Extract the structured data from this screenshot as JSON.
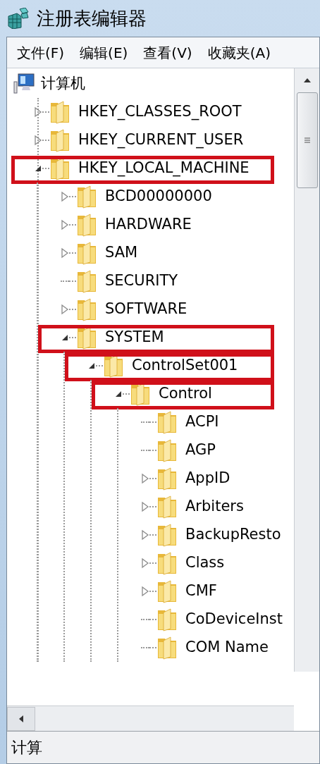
{
  "window": {
    "title": "注册表编辑器"
  },
  "menu": [
    {
      "label": "文件(F)"
    },
    {
      "label": "编辑(E)"
    },
    {
      "label": "查看(V)"
    },
    {
      "label": "收藏夹(A)"
    }
  ],
  "tree": {
    "label": "计算机",
    "children": [
      {
        "label": "HKEY_CLASSES_ROOT",
        "kind": "branch",
        "expanded": false,
        "annotated": false
      },
      {
        "label": "HKEY_CURRENT_USER",
        "kind": "branch",
        "expanded": false,
        "annotated": false
      },
      {
        "label": "HKEY_LOCAL_MACHINE",
        "kind": "branch",
        "expanded": true,
        "annotated": true,
        "children": [
          {
            "label": "BCD00000000",
            "kind": "branch",
            "expanded": false,
            "annotated": false
          },
          {
            "label": "HARDWARE",
            "kind": "branch",
            "expanded": false,
            "annotated": false
          },
          {
            "label": "SAM",
            "kind": "branch",
            "expanded": false,
            "annotated": false
          },
          {
            "label": "SECURITY",
            "kind": "leaf",
            "expanded": false,
            "annotated": false
          },
          {
            "label": "SOFTWARE",
            "kind": "branch",
            "expanded": false,
            "annotated": false
          },
          {
            "label": "SYSTEM",
            "kind": "branch",
            "expanded": true,
            "annotated": true,
            "children": [
              {
                "label": "ControlSet001",
                "kind": "branch",
                "expanded": true,
                "annotated": true,
                "children": [
                  {
                    "label": "Control",
                    "kind": "branch",
                    "expanded": true,
                    "annotated": true,
                    "children": [
                      {
                        "label": "ACPI",
                        "kind": "leaf",
                        "expanded": false,
                        "annotated": false
                      },
                      {
                        "label": "AGP",
                        "kind": "leaf",
                        "expanded": false,
                        "annotated": false
                      },
                      {
                        "label": "AppID",
                        "kind": "branch",
                        "expanded": false,
                        "annotated": false
                      },
                      {
                        "label": "Arbiters",
                        "kind": "branch",
                        "expanded": false,
                        "annotated": false
                      },
                      {
                        "label": "BackupResto",
                        "kind": "branch",
                        "expanded": false,
                        "annotated": false
                      },
                      {
                        "label": "Class",
                        "kind": "branch",
                        "expanded": false,
                        "annotated": false
                      },
                      {
                        "label": "CMF",
                        "kind": "branch",
                        "expanded": false,
                        "annotated": false
                      },
                      {
                        "label": "CoDeviceInst",
                        "kind": "leaf",
                        "expanded": false,
                        "annotated": false
                      },
                      {
                        "label": "COM Name",
                        "kind": "leaf",
                        "expanded": false,
                        "annotated": false
                      }
                    ]
                  }
                ]
              }
            ]
          }
        ]
      }
    ]
  },
  "status_bar": {
    "text": "计算"
  }
}
